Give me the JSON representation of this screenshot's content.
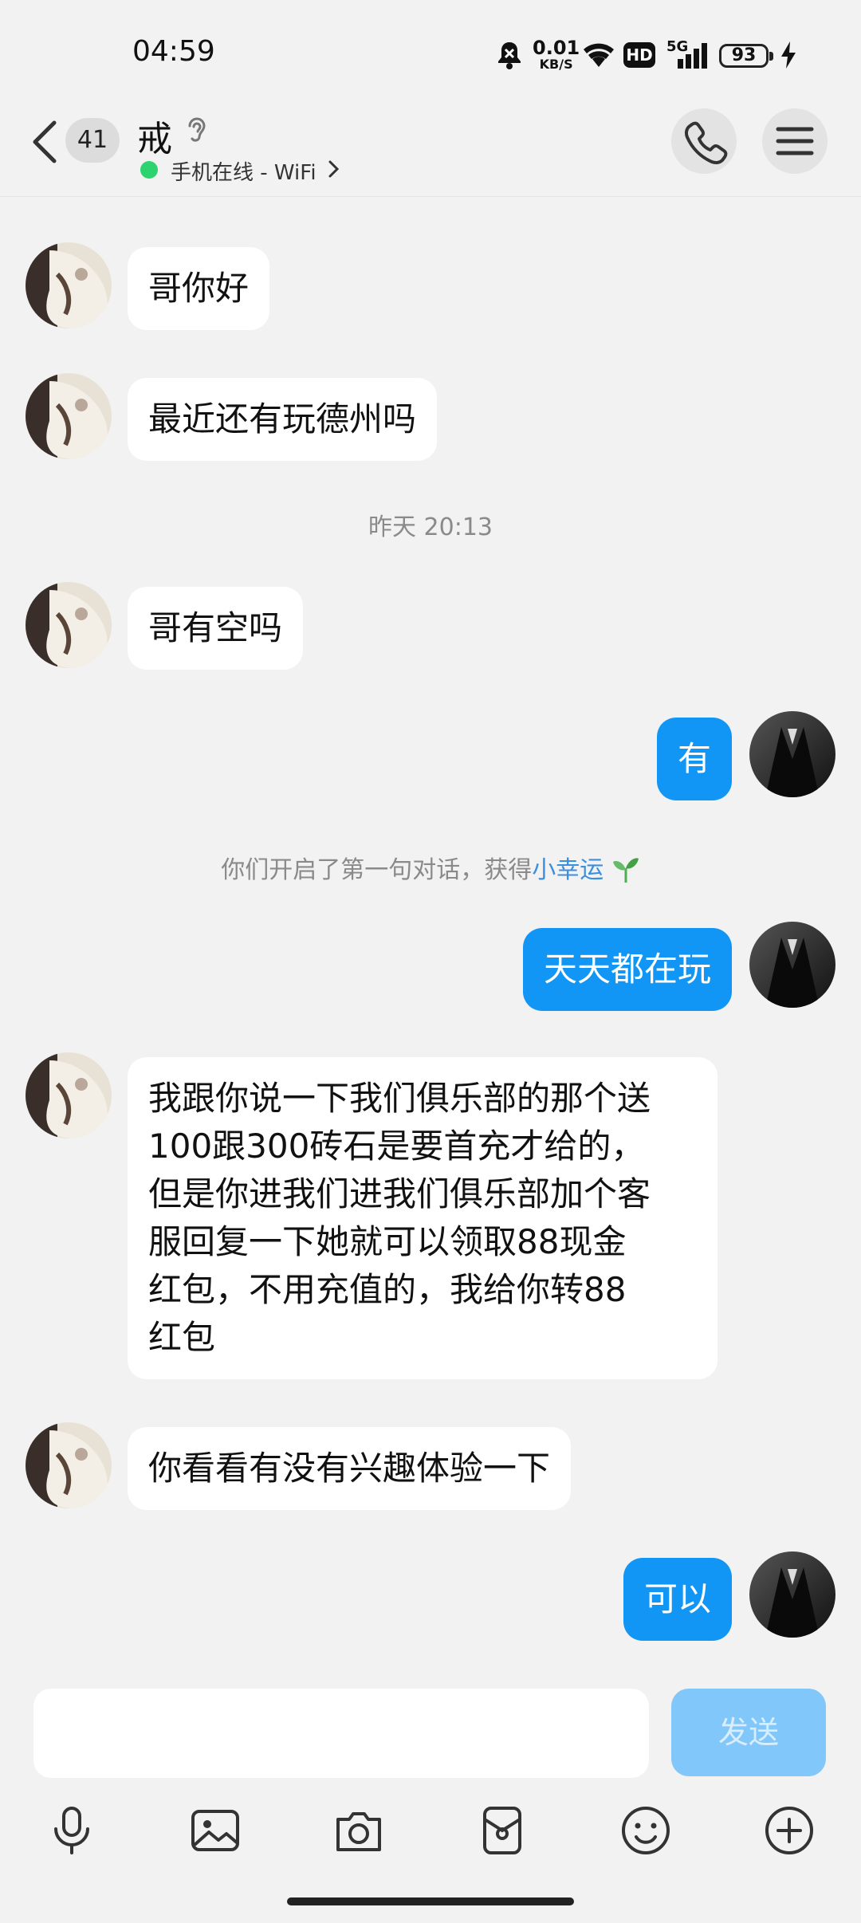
{
  "status_bar": {
    "time": "04:59",
    "net_speed_value": "0.01",
    "net_speed_unit": "KB/S",
    "hd": "HD",
    "network": "5G",
    "battery": "93"
  },
  "header": {
    "unread_badge": "41",
    "title": "戒",
    "subtitle": "手机在线 - WiFi",
    "icons": [
      "back-arrow-icon",
      "ear-icon",
      "phone-icon",
      "menu-icon"
    ]
  },
  "chat": {
    "messages": [
      {
        "side": "left",
        "text": "哥你好"
      },
      {
        "side": "left",
        "text": "最近还有玩德州吗"
      },
      {
        "side": "time",
        "text": "昨天 20:13"
      },
      {
        "side": "left",
        "text": "哥有空吗"
      },
      {
        "side": "right",
        "text": "有"
      },
      {
        "side": "system",
        "text": "你们开启了第一句对话，获得",
        "link": "小幸运"
      },
      {
        "side": "right",
        "text": "天天都在玩"
      },
      {
        "side": "left",
        "lines": [
          "我跟你说一下我们俱乐部的那个送",
          "100跟300砖石是要首充才给的，",
          "但是你进我们进我们俱乐部加个客",
          "服回复一下她就可以领取88现金",
          "红包，不用充值的，我给你转88",
          "红包"
        ]
      },
      {
        "side": "left",
        "text": "你看看有没有兴趣体验一下"
      },
      {
        "side": "right",
        "text": "可以"
      }
    ]
  },
  "input": {
    "value": "",
    "send_label": "发送"
  },
  "toolbar": {
    "icons": [
      "microphone-icon",
      "image-icon",
      "camera-icon",
      "pocket-icon",
      "emoji-icon",
      "plus-icon"
    ]
  },
  "colors": {
    "accent": "#1296f5",
    "send_disabled": "#82c7fa",
    "online": "#2dd36f",
    "background": "#f2f2f2"
  }
}
